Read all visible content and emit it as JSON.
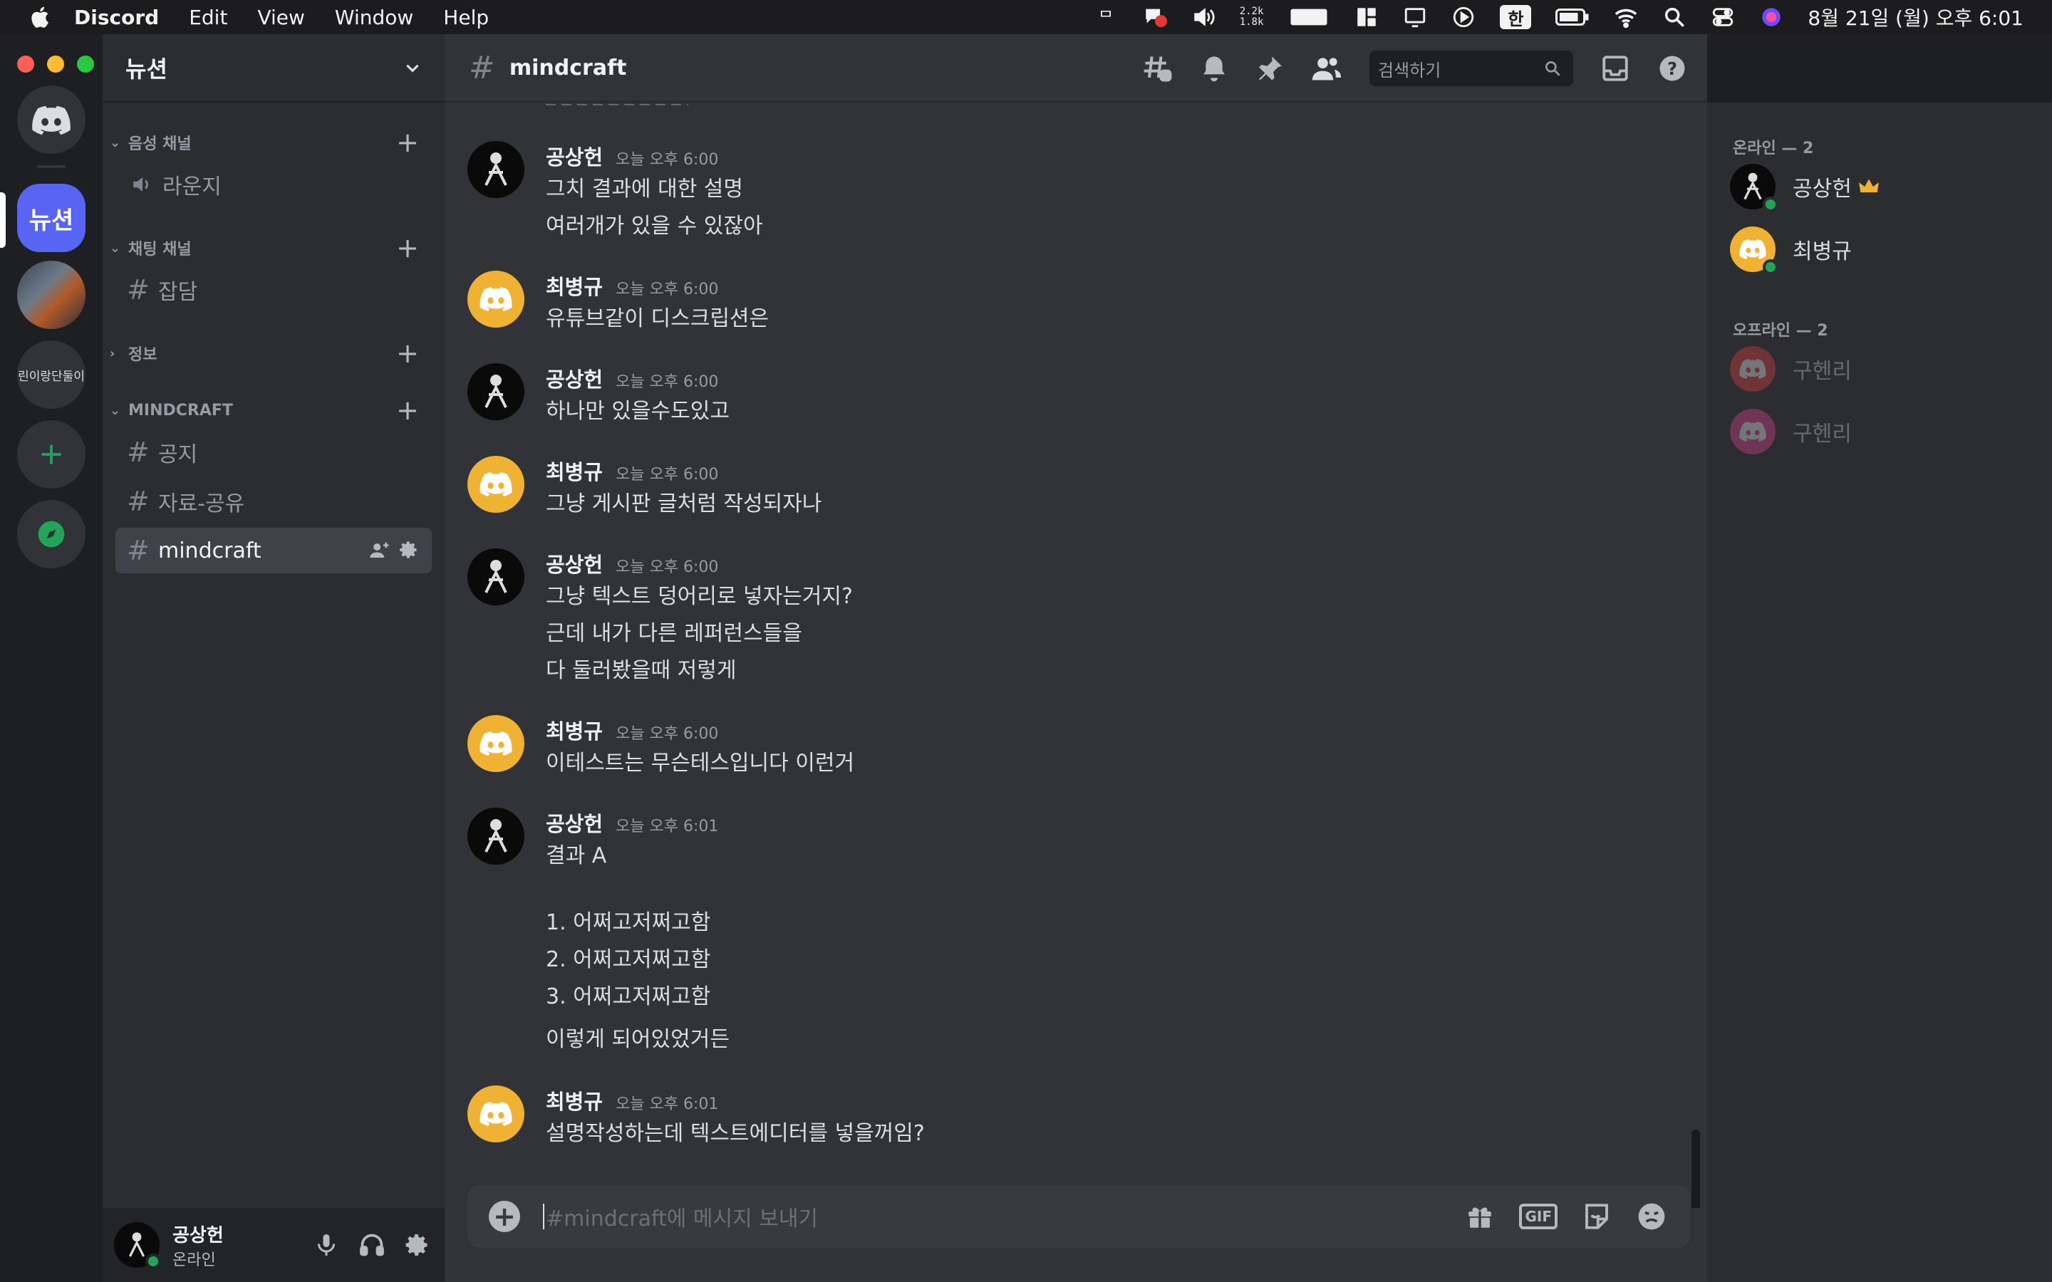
{
  "menubar": {
    "app": "Discord",
    "items": [
      "Edit",
      "View",
      "Window",
      "Help"
    ],
    "net_up": "2.2k",
    "net_down": "1.8k",
    "input_lang": "한",
    "clock": "8월 21일 (월) 오후 6:01"
  },
  "servers": {
    "active_label": "뉴션",
    "text_server_label": "린이랑단둘이"
  },
  "guild": {
    "name": "뉴션",
    "categories": [
      {
        "name": "음성 채널",
        "channels": [
          {
            "name": "라운지",
            "type": "voice"
          }
        ]
      },
      {
        "name": "채팅 채널",
        "channels": [
          {
            "name": "잡담",
            "type": "text"
          }
        ]
      },
      {
        "name": "정보",
        "channels": []
      },
      {
        "name": "MINDCRAFT",
        "channels": [
          {
            "name": "공지",
            "type": "text"
          },
          {
            "name": "자료-공유",
            "type": "text"
          },
          {
            "name": "mindcraft",
            "type": "text",
            "active": true
          }
        ]
      }
    ]
  },
  "user": {
    "name": "공상헌",
    "status": "온라인"
  },
  "channel": {
    "name": "mindcraft",
    "search_placeholder": "검색하기"
  },
  "messages": [
    {
      "author": "공상헌",
      "time": "오늘 오후 6:00",
      "avatar": "dark",
      "lines": [
        "그치 결과에 대한 설명",
        "여러개가 있을 수 있잖아"
      ]
    },
    {
      "author": "최병규",
      "time": "오늘 오후 6:00",
      "avatar": "yellow",
      "lines": [
        "유튜브같이 디스크립션은"
      ]
    },
    {
      "author": "공상헌",
      "time": "오늘 오후 6:00",
      "avatar": "dark",
      "lines": [
        "하나만 있을수도있고"
      ]
    },
    {
      "author": "최병규",
      "time": "오늘 오후 6:00",
      "avatar": "yellow",
      "lines": [
        "그냥 게시판 글처럼 작성되자나"
      ]
    },
    {
      "author": "공상헌",
      "time": "오늘 오후 6:00",
      "avatar": "dark",
      "lines": [
        "그냥 텍스트 덩어리로 넣자는거지?",
        "근데 내가 다른 레퍼런스들을",
        "다 둘러봤을때 저렇게"
      ]
    },
    {
      "author": "최병규",
      "time": "오늘 오후 6:00",
      "avatar": "yellow",
      "lines": [
        "이테스트는 무슨테스입니다 이런거"
      ]
    },
    {
      "author": "공상헌",
      "time": "오늘 오후 6:01",
      "avatar": "dark",
      "lines": [
        "결과 A",
        "1. 어쩌고저쩌고함",
        "2. 어쩌고저쩌고함",
        "3. 어쩌고저쩌고함",
        "이렇게 되어있었거든"
      ]
    },
    {
      "author": "최병규",
      "time": "오늘 오후 6:01",
      "avatar": "yellow",
      "lines": [
        "설명작성하는데 텍스트에디터를 넣을꺼임?"
      ]
    }
  ],
  "composer": {
    "placeholder": "#mindcraft에 메시지 보내기",
    "gif_label": "GIF"
  },
  "members": {
    "online_header": "온라인 — 2",
    "offline_header": "오프라인 — 2",
    "online": [
      {
        "name": "공상헌",
        "owner": true,
        "avatar": "dark"
      },
      {
        "name": "최병규",
        "avatar": "yellow"
      }
    ],
    "offline": [
      {
        "name": "구헨리"
      },
      {
        "name": "구헨리"
      }
    ]
  }
}
